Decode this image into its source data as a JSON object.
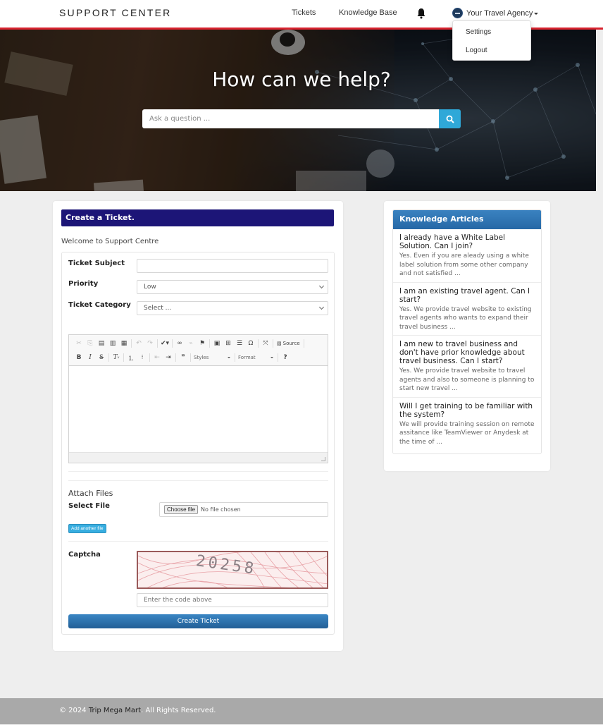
{
  "navbar": {
    "brand": "SUPPORT CENTER",
    "links": [
      "Tickets",
      "Knowledge Base"
    ],
    "user_name": "Your Travel Agency",
    "dropdown": [
      "Settings",
      "Logout"
    ],
    "accent_color": "#d8232f"
  },
  "hero": {
    "title": "How can we help?",
    "search_placeholder": "Ask a question ...",
    "search_button_color": "#2fa8d8"
  },
  "ticket_form": {
    "header": "Create a Ticket.",
    "header_color": "#1c1577",
    "welcome": "Welcome to Support Centre",
    "subject_label": "Ticket Subject",
    "subject_value": "",
    "priority_label": "Priority",
    "priority_value": "Low",
    "category_label": "Ticket Category",
    "category_value": "Select ...",
    "editor": {
      "toolbar_row1": [
        "cut",
        "copy",
        "paste",
        "paste-text",
        "paste-word",
        "undo",
        "redo",
        "spellcheck",
        "link",
        "unlink",
        "anchor",
        "image",
        "table",
        "horizontal-line",
        "special-char",
        "maximize",
        "source"
      ],
      "source_label": "Source",
      "toolbar_row2": [
        "bold",
        "italic",
        "strike",
        "remove-format",
        "numbered-list",
        "bulleted-list",
        "outdent",
        "indent",
        "blockquote",
        "styles",
        "format",
        "help"
      ],
      "styles_label": "Styles",
      "format_label": "Format",
      "body": ""
    },
    "attach_title": "Attach Files",
    "select_file_label": "Select File",
    "choose_file_label": "Choose file",
    "no_file_text": "No file chosen",
    "add_file_label": "Add another file",
    "captcha_label": "Captcha",
    "captcha_code": "20258",
    "captcha_placeholder": "Enter the code above",
    "submit_label": "Create Ticket"
  },
  "knowledge": {
    "header": "Knowledge Articles",
    "articles": [
      {
        "title": "I already have a White Label Solution. Can I join?",
        "desc": "Yes. Even if you are aleady using a white label solution from some other company and not satisfied ..."
      },
      {
        "title": "I am an existing travel agent. Can I start?",
        "desc": "Yes. We provide travel website to existing travel agents who wants to expand their travel business ..."
      },
      {
        "title": "I am new to travel business and don't have prior knowledge about travel business. Can I start?",
        "desc": "Yes. We provide travel website to travel agents and also to someone is planning to start new travel ..."
      },
      {
        "title": "Will I get training to be familiar with the system?",
        "desc": "We will provide training session on remote assitance like TeamViewer or Anydesk at the time of ..."
      }
    ]
  },
  "footer": {
    "prefix": "© 2024 ",
    "company": "Trip Mega Mart",
    "suffix": ". All Rights Reserved."
  }
}
